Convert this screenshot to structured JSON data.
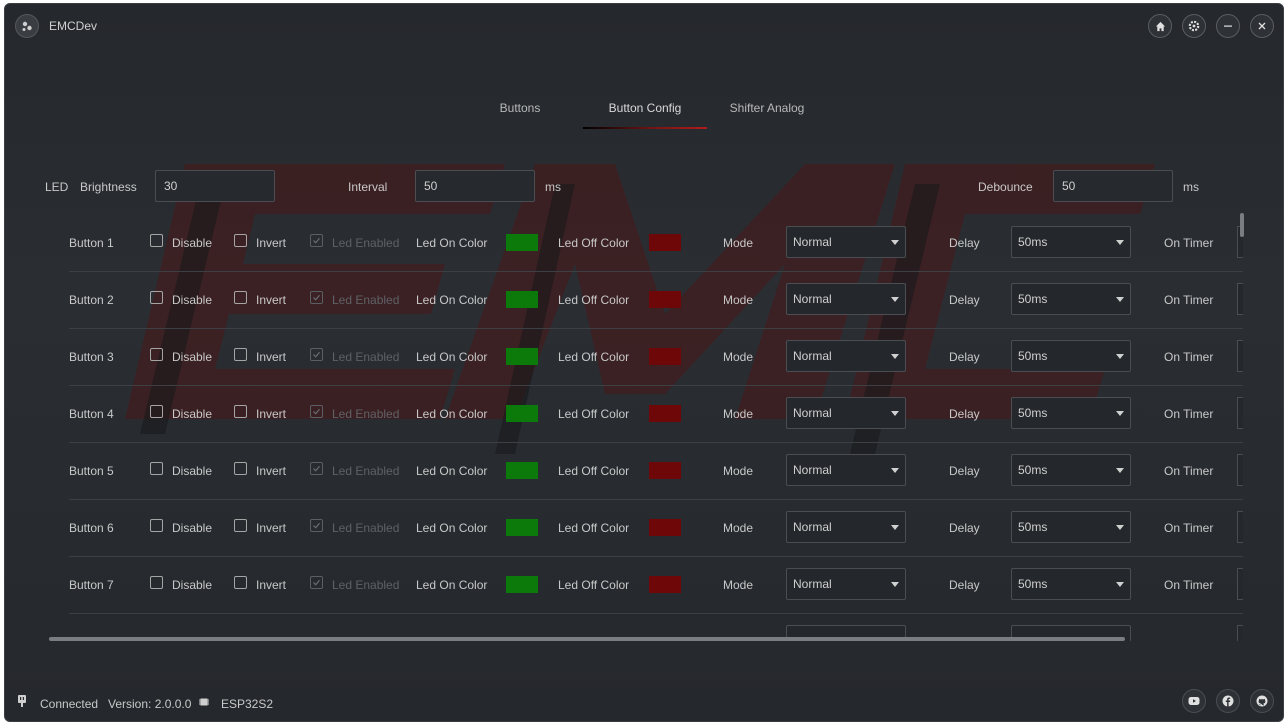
{
  "app": {
    "title": "EMCDev"
  },
  "window_controls": {
    "home_icon": "home-icon",
    "settings_icon": "gear-icon",
    "minimize_icon": "minimize-icon",
    "close_icon": "close-icon"
  },
  "tabs": [
    {
      "label": "Buttons",
      "active": false
    },
    {
      "label": "Button Config",
      "active": true
    },
    {
      "label": "Shifter Analog",
      "active": false
    }
  ],
  "led_settings": {
    "section_label": "LED",
    "brightness_label": "Brightness",
    "brightness_value": "30",
    "interval_label": "Interval",
    "interval_value": "50",
    "interval_unit": "ms",
    "debounce_label": "Debounce",
    "debounce_value": "50",
    "debounce_unit": "ms"
  },
  "row_labels": {
    "disable": "Disable",
    "invert": "Invert",
    "led_enabled": "Led Enabled",
    "led_on_color": "Led On Color",
    "led_off_color": "Led Off Color",
    "mode": "Mode",
    "delay": "Delay",
    "on_timer": "On Timer"
  },
  "colors": {
    "led_on": "#0b7a0b",
    "led_off": "#6e0707",
    "accent": "#b01c1c"
  },
  "buttons": [
    {
      "name": "Button 1",
      "disable": false,
      "invert": false,
      "led_enabled": true,
      "mode": "Normal",
      "delay": "50ms"
    },
    {
      "name": "Button 2",
      "disable": false,
      "invert": false,
      "led_enabled": true,
      "mode": "Normal",
      "delay": "50ms"
    },
    {
      "name": "Button 3",
      "disable": false,
      "invert": false,
      "led_enabled": true,
      "mode": "Normal",
      "delay": "50ms"
    },
    {
      "name": "Button 4",
      "disable": false,
      "invert": false,
      "led_enabled": true,
      "mode": "Normal",
      "delay": "50ms"
    },
    {
      "name": "Button 5",
      "disable": false,
      "invert": false,
      "led_enabled": true,
      "mode": "Normal",
      "delay": "50ms"
    },
    {
      "name": "Button 6",
      "disable": false,
      "invert": false,
      "led_enabled": true,
      "mode": "Normal",
      "delay": "50ms"
    },
    {
      "name": "Button 7",
      "disable": false,
      "invert": false,
      "led_enabled": true,
      "mode": "Normal",
      "delay": "50ms"
    }
  ],
  "status": {
    "connection": "Connected",
    "version": "Version: 2.0.0.0",
    "board": "ESP32S2"
  },
  "footer_links": [
    {
      "icon": "youtube-icon"
    },
    {
      "icon": "facebook-icon"
    },
    {
      "icon": "github-icon"
    }
  ]
}
